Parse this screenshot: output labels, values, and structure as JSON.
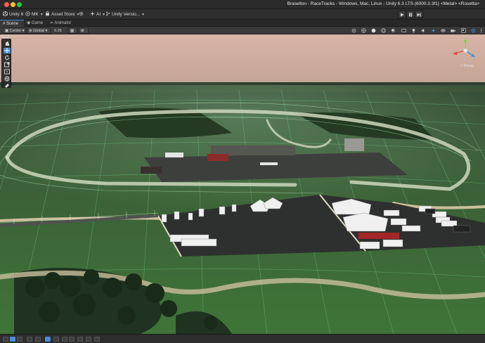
{
  "window": {
    "title": "Braselton - RaceTracks - Windows, Mac, Linux - Unity 6.3 LTS (6000.3.3f1) <Metal> <Rosetta>",
    "traffic_colors": [
      "#ff5f57",
      "#febc2e",
      "#28c840"
    ]
  },
  "toolbar": {
    "unity_label": "Unity 6",
    "account_label": "MK",
    "asset_store_label": "Asset Store",
    "ai_label": "AI",
    "version_control_label": "Unity Versio..."
  },
  "tabs": [
    {
      "label": "Scene",
      "active": true,
      "icon": "hash-icon"
    },
    {
      "label": "Game",
      "active": false,
      "icon": "gamepad-icon"
    },
    {
      "label": "Animator",
      "active": false,
      "icon": "animator-icon"
    }
  ],
  "scene_toolbar": {
    "pivot_label": "Center",
    "space_label": "Global",
    "snap_value": "0.25"
  },
  "viewport": {
    "persp_label": "< Persp",
    "sky_color": "#cda898",
    "grass_color": "#3f6b3a",
    "wire_color": "#8fffb0"
  },
  "colors": {
    "accent": "#4a8cd6",
    "titlebar": "#2b2b2b",
    "toolbar": "#2e2e2e"
  }
}
